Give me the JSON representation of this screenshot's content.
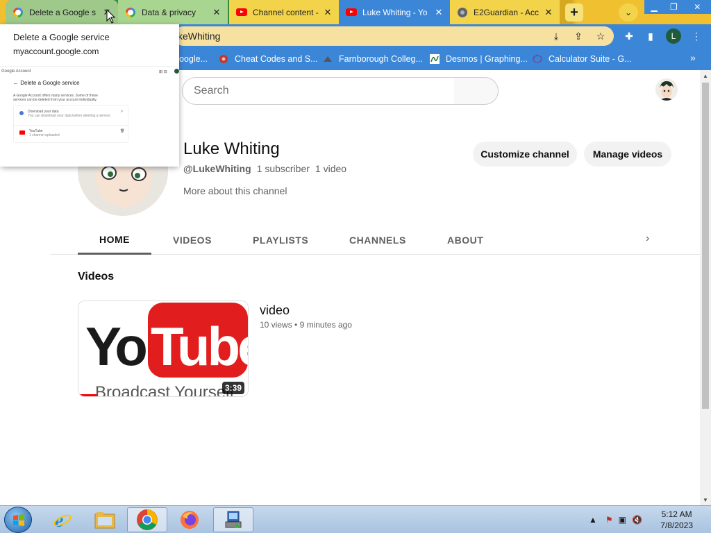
{
  "browser": {
    "tabs": [
      {
        "title": "Delete a Google s",
        "favicon": "google-icon",
        "active": false,
        "hovered": true
      },
      {
        "title": "Data & privacy",
        "favicon": "google-icon",
        "active": false
      },
      {
        "title": "Channel content -",
        "favicon": "youtube-icon",
        "active": false
      },
      {
        "title": "Luke Whiting - Yo",
        "favicon": "youtube-icon",
        "active": true
      },
      {
        "title": "E2Guardian - Acc",
        "favicon": "globe-icon",
        "active": false
      }
    ],
    "address_text": "keWhiting",
    "profile_initial": "L",
    "bookmarks": [
      {
        "label": "oogle...",
        "icon": "bookmark-icon"
      },
      {
        "label": "Cheat Codes and S...",
        "icon": "cheat-codes-icon"
      },
      {
        "label": "Farnborough Colleg...",
        "icon": "college-icon"
      },
      {
        "label": "Desmos | Graphing...",
        "icon": "desmos-icon"
      },
      {
        "label": "Calculator Suite - G...",
        "icon": "geogebra-icon"
      }
    ],
    "bookmarks_more": "»"
  },
  "hover_card": {
    "title": "Delete a Google service",
    "url": "myaccount.google.com",
    "preview": {
      "header": "Google Account",
      "back_title": "Delete a Google service",
      "description": "A Google Account offers many services. Some of these services can be deleted from your account individually.",
      "row1_title": "Download your data",
      "row1_sub": "You can download your data before deleting a service",
      "row2_title": "YouTube",
      "row2_sub": "1 channel uploaded"
    }
  },
  "youtube": {
    "search_placeholder": "Search",
    "channel": {
      "name": "Luke Whiting",
      "handle": "@LukeWhiting",
      "subscribers": "1 subscriber",
      "videos_count": "1 video",
      "more_about": "More about this channel"
    },
    "buttons": {
      "customize": "Customize channel",
      "manage": "Manage videos"
    },
    "tabs": [
      "HOME",
      "VIDEOS",
      "PLAYLISTS",
      "CHANNELS",
      "ABOUT"
    ],
    "active_tab": "HOME",
    "section_title": "Videos",
    "video": {
      "title": "video",
      "views": "10 views",
      "age": "9 minutes ago",
      "duration": "3:39",
      "thumb_text_you": "You",
      "thumb_text_tube": "Tube",
      "thumb_tagline": "Broadcast Yourself"
    }
  },
  "taskbar": {
    "clock_time": "5:12 AM",
    "clock_date": "7/8/2023"
  },
  "colors": {
    "chrome_theme_blue": "#3c86d8",
    "chrome_theme_yellow": "#f0c030",
    "youtube_red": "#ff0000"
  }
}
